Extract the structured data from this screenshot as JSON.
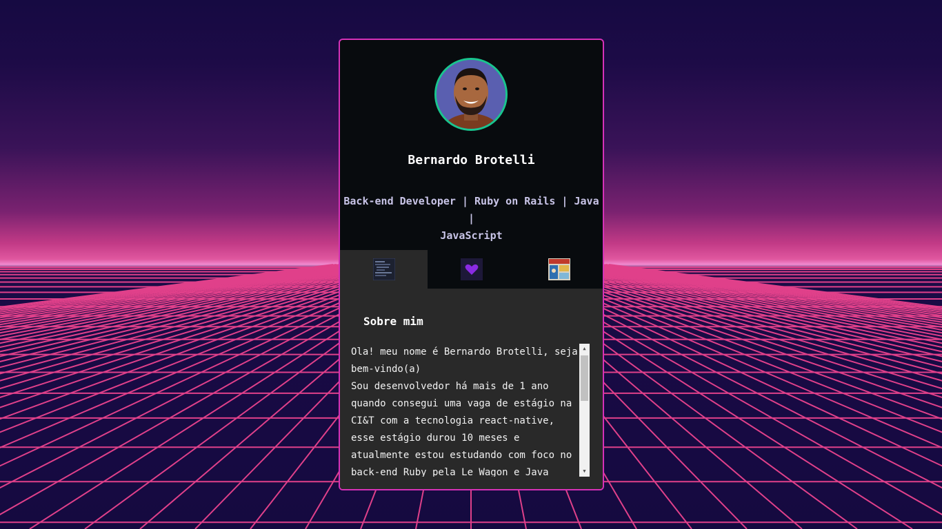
{
  "profile": {
    "name": "Bernardo Brotelli",
    "subtitle_line1": "Back-end Developer | Ruby on Rails | Java |",
    "subtitle_line2": "JavaScript"
  },
  "tabs": [
    {
      "icon": "code-screenshot-icon",
      "active": true
    },
    {
      "icon": "heart-icon",
      "active": false
    },
    {
      "icon": "comic-icon",
      "active": false
    }
  ],
  "about": {
    "title": "Sobre mim",
    "text": "Ola! meu nome é Bernardo Brotelli, seja bem-vindo(a)\nSou desenvolvedor há mais de 1 ano quando consegui uma vaga de estágio na CI&T com a tecnologia react-native, esse estágio durou 10 meses e atualmente estou estudando com foco no back-end Ruby pela Le Wagon e Java"
  },
  "colors": {
    "card_border": "#d631b8",
    "avatar_ring": "#19c58e",
    "heart": "#8a2be2",
    "grid_line": "#e0408a"
  }
}
